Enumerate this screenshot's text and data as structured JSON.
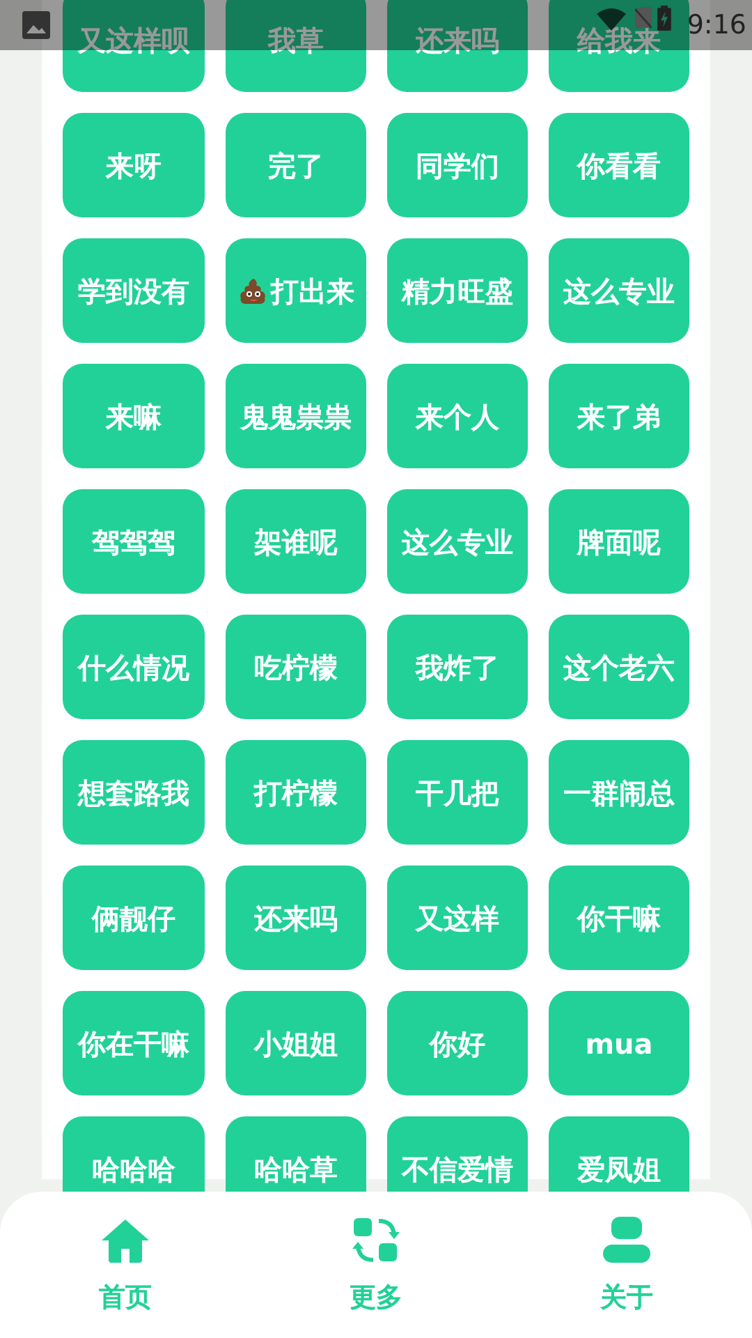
{
  "status_bar": {
    "time": "9:16"
  },
  "buttons": [
    {
      "label": "又这样呗"
    },
    {
      "label": "我草"
    },
    {
      "label": "还来吗"
    },
    {
      "label": "给我来"
    },
    {
      "label": "来呀"
    },
    {
      "label": "完了"
    },
    {
      "label": "同学们"
    },
    {
      "label": "你看看"
    },
    {
      "label": "学到没有"
    },
    {
      "label": "打出来",
      "kind": "poop"
    },
    {
      "label": "精力旺盛"
    },
    {
      "label": "这么专业"
    },
    {
      "label": "来嘛"
    },
    {
      "label": "鬼鬼祟祟"
    },
    {
      "label": "来个人"
    },
    {
      "label": "来了弟"
    },
    {
      "label": "驾驾驾"
    },
    {
      "label": "架谁呢"
    },
    {
      "label": "这么专业"
    },
    {
      "label": "牌面呢"
    },
    {
      "label": "什么情况"
    },
    {
      "label": "吃柠檬"
    },
    {
      "label": "我炸了"
    },
    {
      "label": "这个老六"
    },
    {
      "label": "想套路我"
    },
    {
      "label": "打柠檬"
    },
    {
      "label": "干几把"
    },
    {
      "label": "一群闹总"
    },
    {
      "label": "俩靓仔"
    },
    {
      "label": "还来吗"
    },
    {
      "label": "又这样"
    },
    {
      "label": "你干嘛"
    },
    {
      "label": "你在干嘛"
    },
    {
      "label": "小姐姐"
    },
    {
      "label": "你好"
    },
    {
      "label": "mua"
    },
    {
      "label": "哈哈哈"
    },
    {
      "label": "哈哈草"
    },
    {
      "label": "不信爱情"
    },
    {
      "label": "爱凤姐"
    }
  ],
  "bottom_nav": [
    {
      "label": "首页",
      "kind": "home"
    },
    {
      "label": "更多",
      "kind": "swap"
    },
    {
      "label": "关于",
      "kind": "person"
    }
  ]
}
